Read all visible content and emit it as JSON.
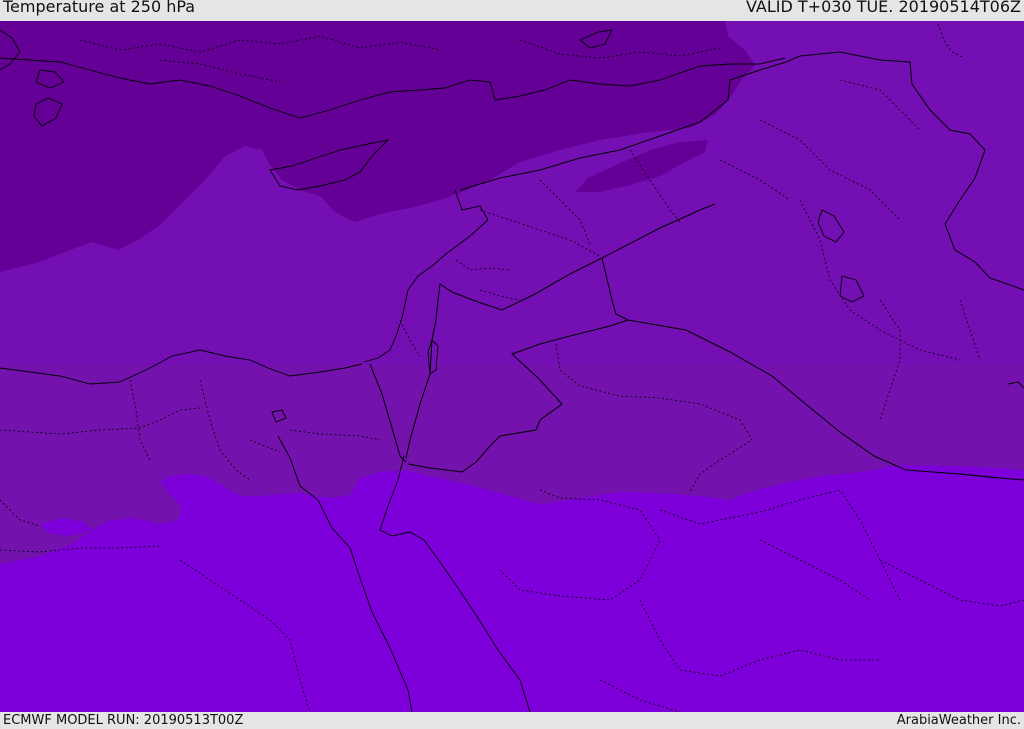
{
  "header": {
    "title": "Temperature at 250 hPa",
    "valid_time": "VALID T+030 TUE. 20190514T06Z"
  },
  "footer": {
    "model_run": "ECMWF MODEL RUN: 20190513T00Z",
    "credit": "ArabiaWeather Inc."
  },
  "colors": {
    "cold_band": "#650096",
    "mid_band": "#7410b3",
    "mid_band_alt": "#7412ad",
    "warm_band": "#7d00db",
    "borders": "#000000",
    "chrome": "#e5e5e5"
  },
  "map": {
    "icons": [
      "coastline-layer",
      "country-border-layer",
      "province-border-layer"
    ]
  }
}
